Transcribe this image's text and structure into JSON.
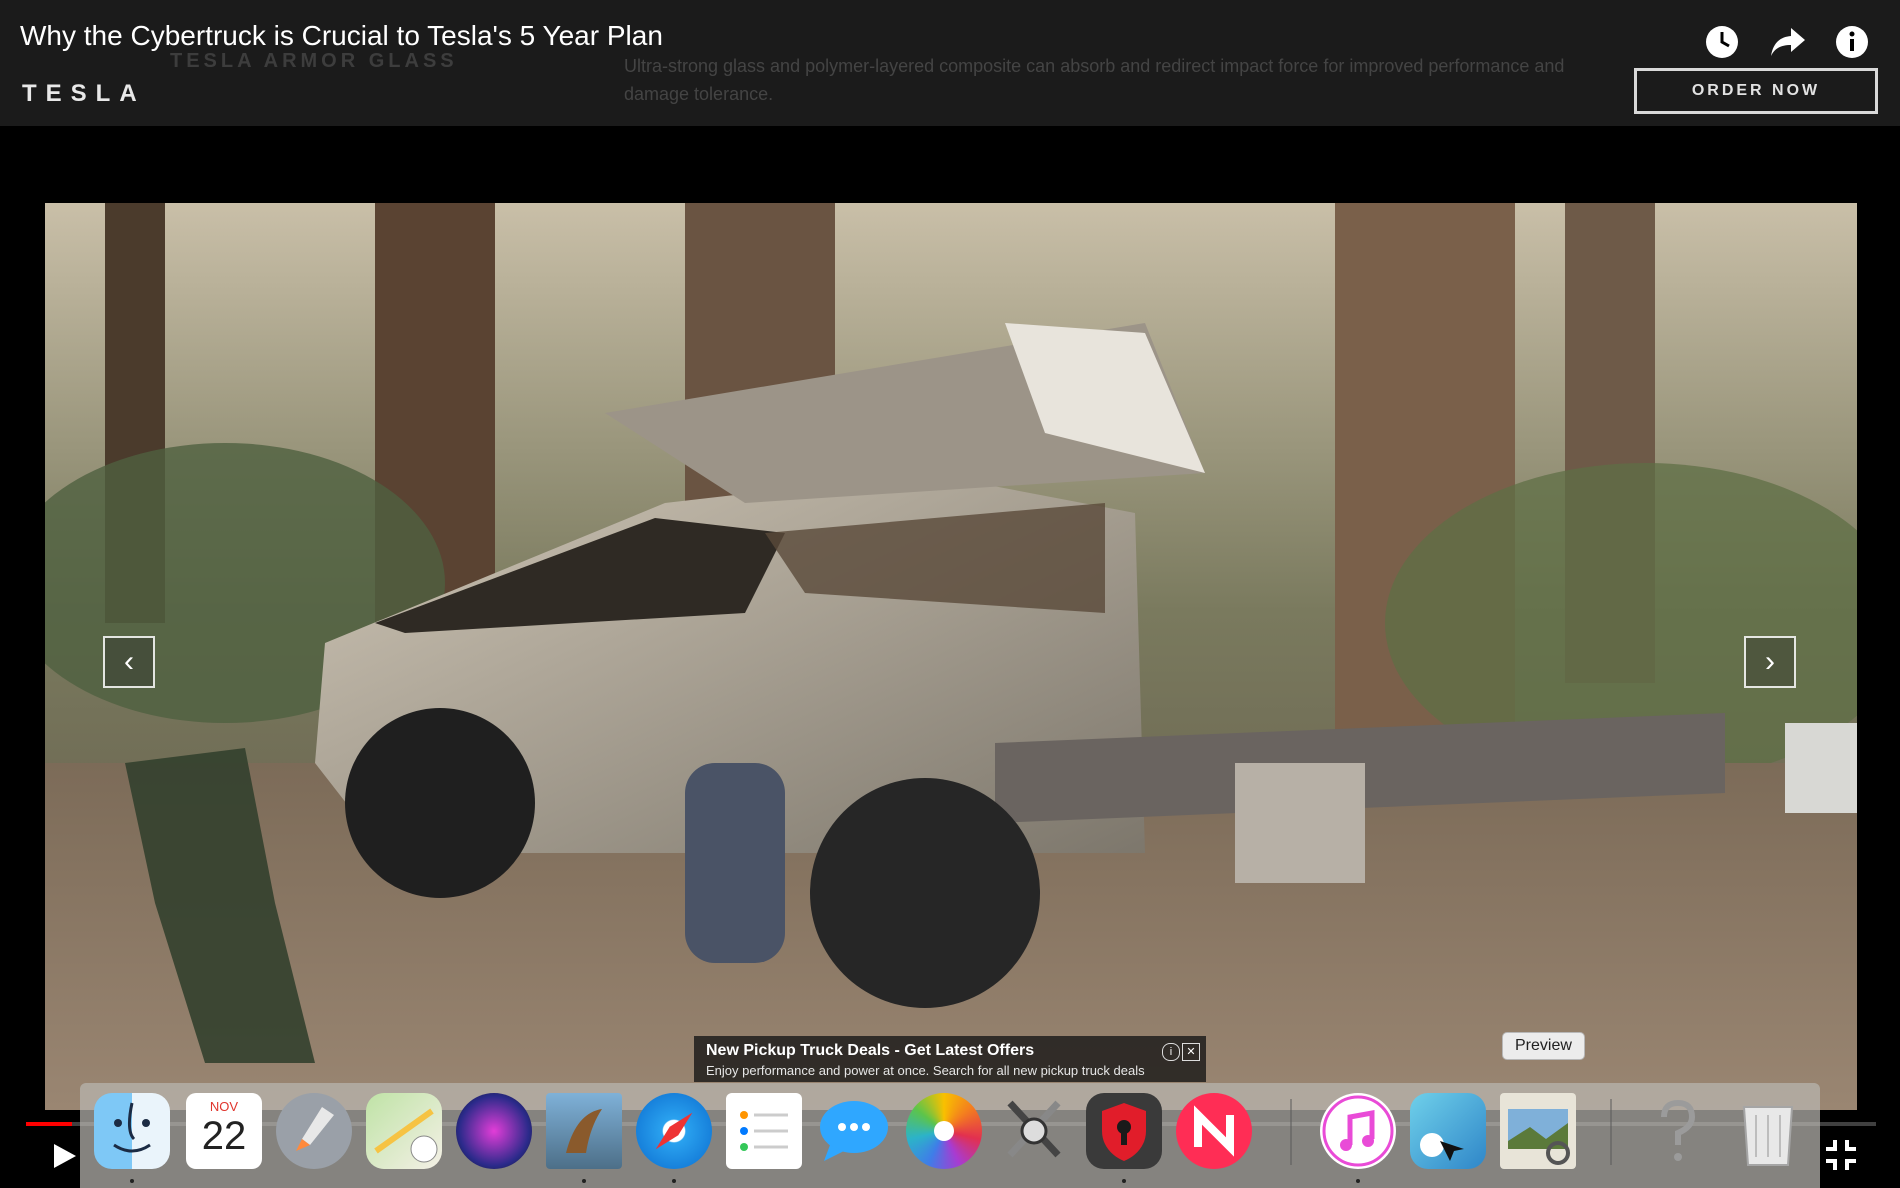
{
  "video": {
    "title": "Why the Cybertruck is Crucial to Tesla's 5 Year Plan",
    "icons": [
      "clock-icon",
      "share-icon",
      "info-icon"
    ],
    "progress": 0.025
  },
  "site": {
    "logo": "TESLA",
    "faded_heading": "TESLA ARMOR GLASS",
    "faded_text": "Ultra-strong glass and polymer-layered composite can absorb and redirect impact force for improved performance and damage tolerance.",
    "order_button": "ORDER NOW"
  },
  "gallery": {
    "prev_arrow": "‹",
    "next_arrow": "›"
  },
  "ad": {
    "title": "New Pickup Truck Deals - Get Latest Offers",
    "description": "Enjoy performance and power at once. Search for all new pickup truck deals",
    "info": "i",
    "close": "✕"
  },
  "dock": {
    "calendar_month": "NOV",
    "calendar_day": "22",
    "tooltip": "Preview",
    "apps": [
      "Finder",
      "Calendar",
      "Launchpad",
      "Maps",
      "Siri",
      "Mail",
      "Safari",
      "Reminders",
      "Messages",
      "Photos",
      "System Preferences",
      "Security",
      "News",
      "Music",
      "Preview Screen",
      "Preview",
      "Help",
      "Trash"
    ]
  },
  "colors": {
    "progress": "#ff0000",
    "dock": "#b9b6b0"
  }
}
